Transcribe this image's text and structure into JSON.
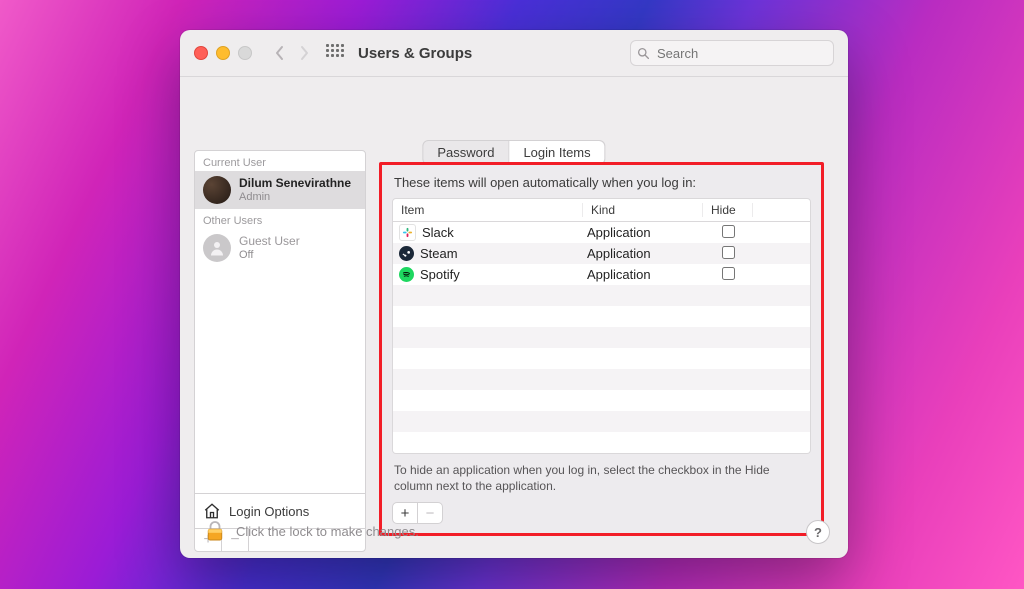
{
  "window_title": "Users & Groups",
  "search": {
    "placeholder": "Search"
  },
  "sidebar": {
    "section_current": "Current User",
    "section_other": "Other Users",
    "current_user": {
      "name": "Dilum Senevirathne",
      "role": "Admin"
    },
    "guest_user": {
      "name": "Guest User",
      "role": "Off"
    },
    "login_options": "Login Options"
  },
  "tabs": {
    "password": "Password",
    "login_items": "Login Items"
  },
  "panel": {
    "heading": "These items will open automatically when you log in:",
    "columns": {
      "item": "Item",
      "kind": "Kind",
      "hide": "Hide"
    },
    "rows": [
      {
        "name": "Slack",
        "kind": "Application",
        "hide": false,
        "icon": "slack"
      },
      {
        "name": "Steam",
        "kind": "Application",
        "hide": false,
        "icon": "steam"
      },
      {
        "name": "Spotify",
        "kind": "Application",
        "hide": false,
        "icon": "spotify"
      }
    ],
    "hint": "To hide an application when you log in, select the checkbox in the Hide column next to the application."
  },
  "footer": {
    "lock_text": "Click the lock to make changes."
  },
  "colors": {
    "highlight_border": "#f21d27"
  }
}
